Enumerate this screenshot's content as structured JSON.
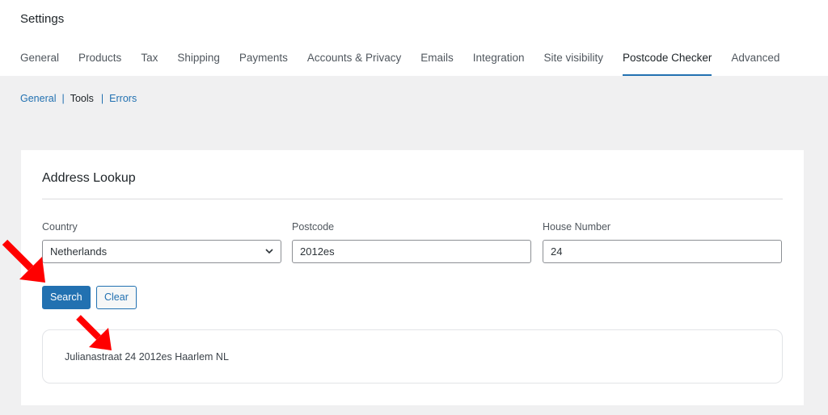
{
  "header": {
    "title": "Settings",
    "tabs": [
      {
        "label": "General"
      },
      {
        "label": "Products"
      },
      {
        "label": "Tax"
      },
      {
        "label": "Shipping"
      },
      {
        "label": "Payments"
      },
      {
        "label": "Accounts & Privacy"
      },
      {
        "label": "Emails"
      },
      {
        "label": "Integration"
      },
      {
        "label": "Site visibility"
      },
      {
        "label": "Postcode Checker"
      },
      {
        "label": "Advanced"
      }
    ],
    "active_tab": "Postcode Checker"
  },
  "subnav": {
    "general": "General",
    "tools": "Tools",
    "errors": "Errors",
    "separator": "|",
    "current": "Tools"
  },
  "card": {
    "title": "Address Lookup",
    "country": {
      "label": "Country",
      "value": "Netherlands"
    },
    "postcode": {
      "label": "Postcode",
      "value": "2012es"
    },
    "house_number": {
      "label": "House Number",
      "value": "24"
    },
    "search_label": "Search",
    "clear_label": "Clear",
    "result": "Julianastraat 24 2012es Haarlem NL"
  },
  "colors": {
    "accent": "#2271b1",
    "arrow": "#ff0000"
  },
  "icons": {
    "select_chevron": "chevron-down-icon",
    "annotation": "red-arrow-icon"
  }
}
